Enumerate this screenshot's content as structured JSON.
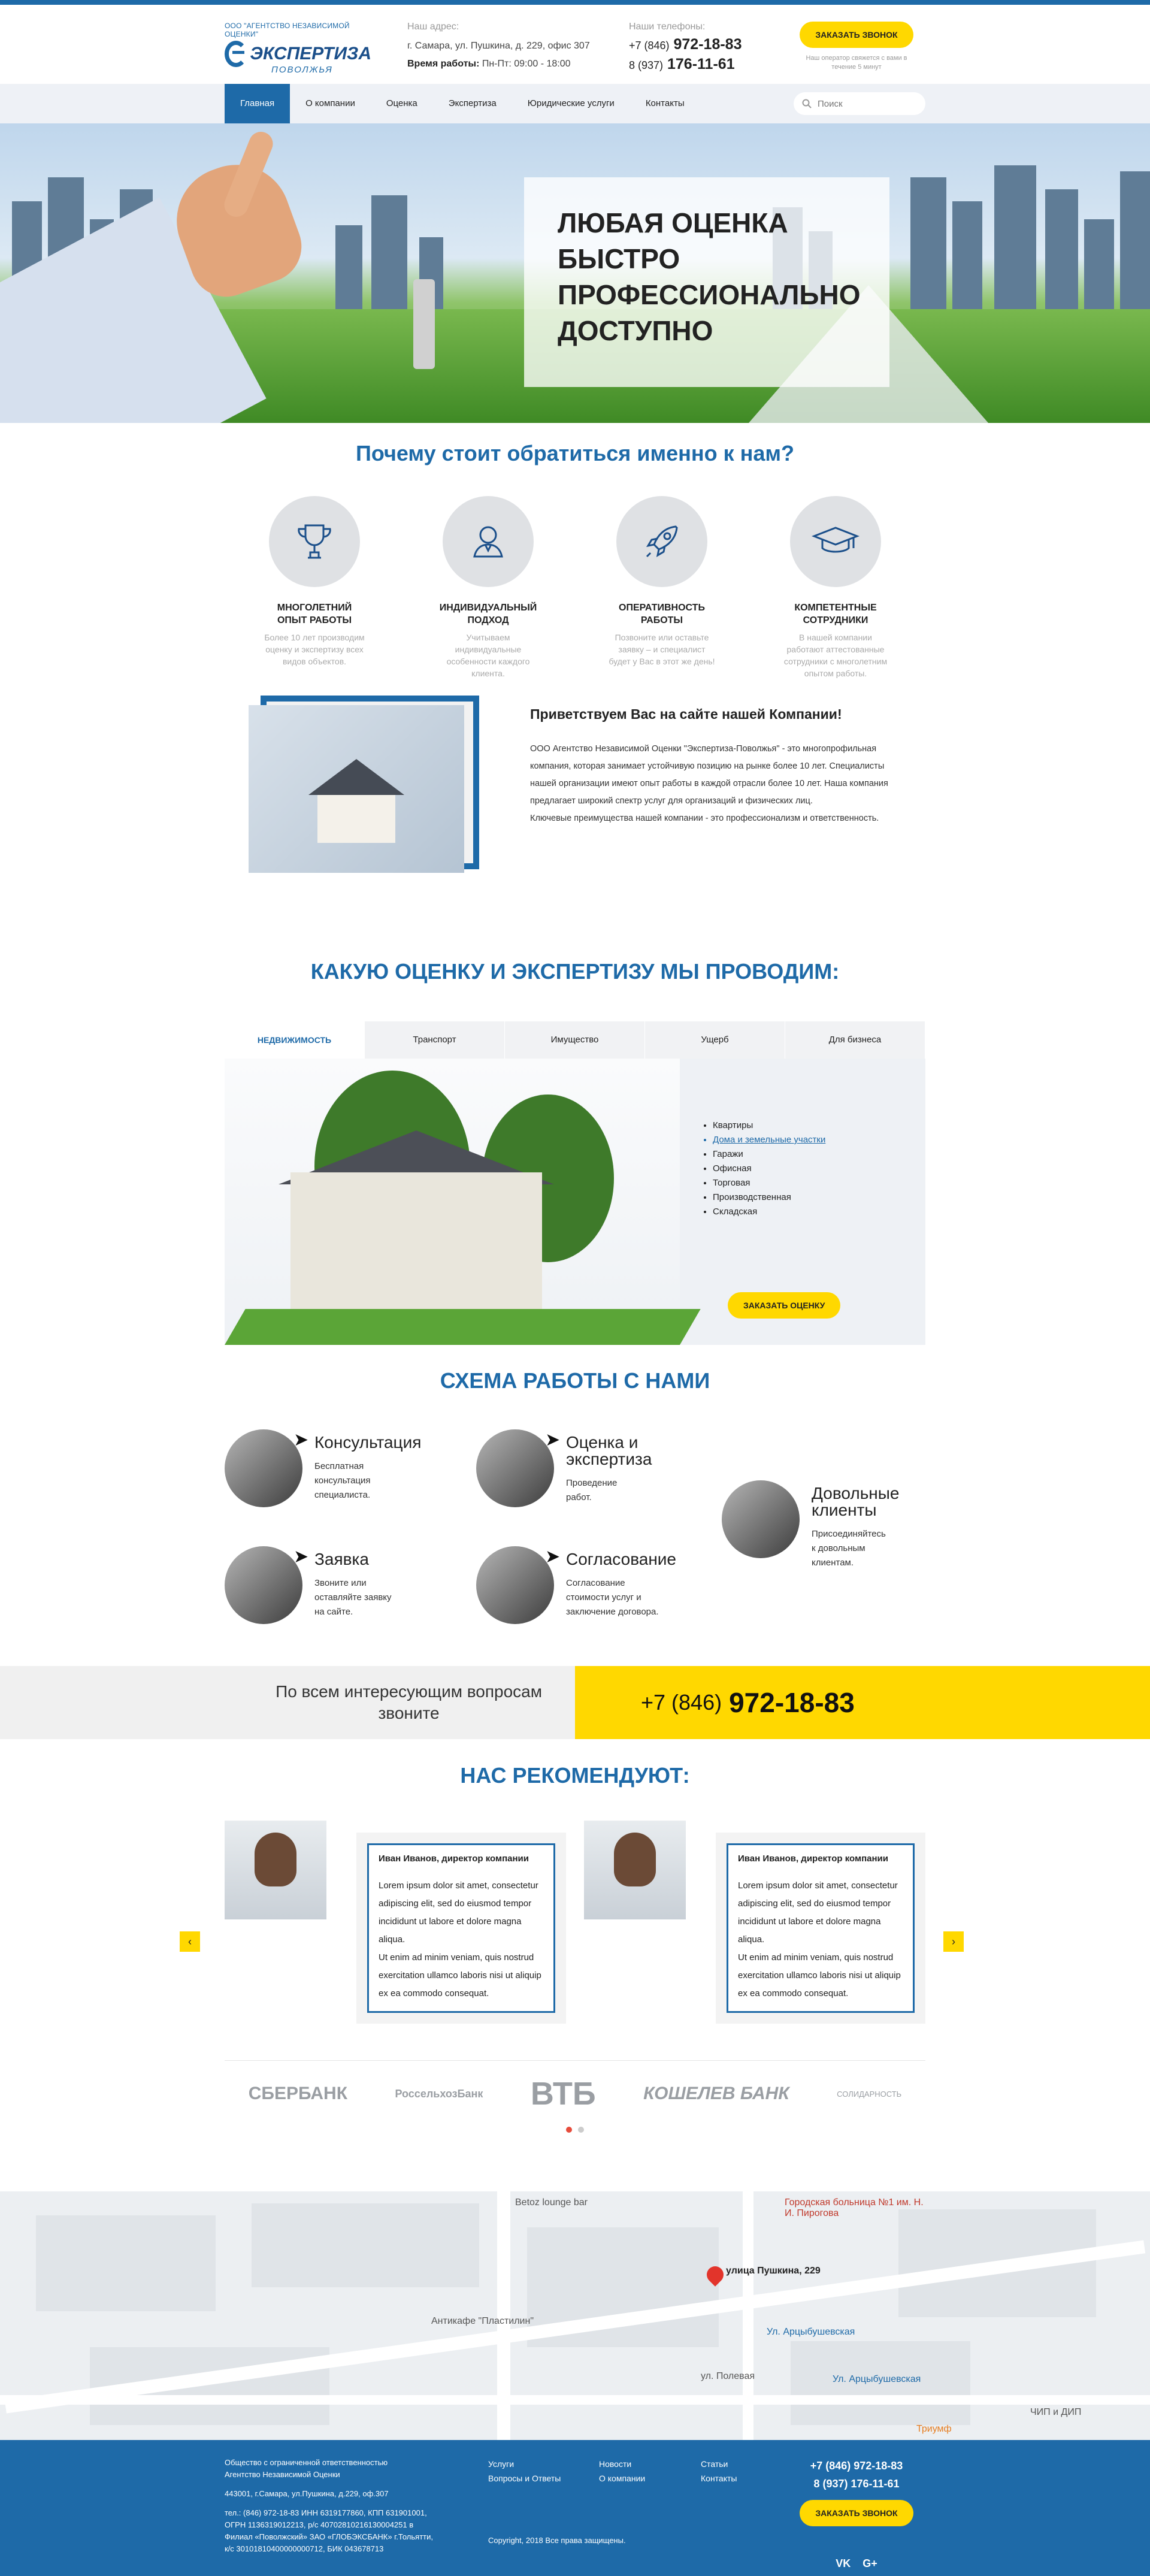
{
  "header": {
    "logo_small": "ООО \"АГЕНТСТВО НЕЗАВИСИМОЙ ОЦЕНКИ\"",
    "logo_main": "ЭКСПЕРТИЗА",
    "logo_sub": "ПОВОЛЖЬЯ",
    "address_label": "Наш адрес:",
    "address": "г. Самара, ул. Пушкина, д. 229, офис 307",
    "hours_label": "Время работы:",
    "hours": "Пн-Пт: 09:00 - 18:00",
    "phones_label": "Наши телефоны:",
    "phone1_code": "+7 (846)",
    "phone1_num": "972-18-83",
    "phone2_code": "8 (937)",
    "phone2_num": "176-11-61",
    "call_button": "ЗАКАЗАТЬ ЗВОНОК",
    "call_note": "Наш оператор свяжется с вами в течение 5 минут"
  },
  "nav": {
    "items": [
      "Главная",
      "О компании",
      "Оценка",
      "Экспертиза",
      "Юридические услуги",
      "Контакты"
    ],
    "search_placeholder": "Поиск"
  },
  "hero": {
    "lines": [
      "ЛЮБАЯ ОЦЕНКА",
      "БЫСТРО",
      "ПРОФЕССИОНАЛЬНО",
      "ДОСТУПНО"
    ]
  },
  "why": {
    "title": "Почему стоит обратиться именно к нам?",
    "features": [
      {
        "title1": "МНОГОЛЕТНИЙ",
        "title2": "ОПЫТ РАБОТЫ",
        "text": "Более 10 лет производим оценку и экспертизу всех видов объектов."
      },
      {
        "title1": "ИНДИВИДУАЛЬНЫЙ",
        "title2": "ПОДХОД",
        "text": "Учитываем индивидуальные особенности каждого клиента."
      },
      {
        "title1": "ОПЕРАТИВНОСТЬ",
        "title2": "РАБОТЫ",
        "text": "Позвоните или оставьте заявку – и специалист будет у Вас в этот же день!"
      },
      {
        "title1": "КОМПЕТЕНТНЫЕ",
        "title2": "СОТРУДНИКИ",
        "text": "В нашей компании работают аттестованные сотрудники с многолетним опытом работы."
      }
    ]
  },
  "welcome": {
    "title": "Приветствуем Вас на сайте нашей Компании!",
    "p1": "ООО Агентство Независимой Оценки \"Экспертиза-Поволжья\" - это многопрофильная компания, которая занимает устойчивую позицию на рынке более 10 лет. Специалисты нашей организации имеют опыт работы в каждой отрасли более 10 лет. Наша компания предлагает широкий спектр услуг для организаций и физических лиц.",
    "p2": "Ключевые преимущества нашей компании - это профессионализм и ответственность."
  },
  "services": {
    "title": "КАКУЮ ОЦЕНКУ И ЭКСПЕРТИЗУ МЫ ПРОВОДИМ:",
    "tabs": [
      "НЕДВИЖИМОСТЬ",
      "Транспорт",
      "Имущество",
      "Ущерб",
      "Для бизнеса"
    ],
    "list": [
      "Квартиры",
      "Дома и земельные участки",
      "Гаражи",
      "Офисная",
      "Торговая",
      "Производственная",
      "Складская"
    ],
    "button": "ЗАКАЗАТЬ ОЦЕНКУ"
  },
  "scheme": {
    "title": "СХЕМА РАБОТЫ С НАМИ",
    "steps": [
      {
        "title": "Консультация",
        "text1": "Бесплатная",
        "text2": "консультация",
        "text3": "специалиста."
      },
      {
        "title": "Оценка и",
        "title2": "экспертиза",
        "text1": "Проведение",
        "text2": "работ."
      },
      {
        "title": "Довольные",
        "title2": "клиенты",
        "text1": "Присоединяйтесь",
        "text2": "к довольным",
        "text3": "клиентам."
      },
      {
        "title": "Заявка",
        "text1": "Звоните или",
        "text2": "оставляйте заявку",
        "text3": "на сайте."
      },
      {
        "title": "Согласование",
        "text1": "Согласование",
        "text2": "стоимости услуг и",
        "text3": "заключение договора."
      }
    ]
  },
  "cta": {
    "text1": "По всем интересующим вопросам",
    "text2": "звоните",
    "code": "+7 (846)",
    "number": "972-18-83"
  },
  "reviews": {
    "title": "НАС РЕКОМЕНДУЮТ:",
    "items": [
      {
        "name": "Иван Иванов, директор компании",
        "p1": "Lorem ipsum dolor sit amet, consectetur adipiscing elit, sed do eiusmod tempor incididunt ut labore et dolore magna aliqua.",
        "p2": "Ut enim ad minim veniam, quis nostrud exercitation ullamco laboris nisi ut aliquip ex ea commodo consequat."
      },
      {
        "name": "Иван Иванов, директор компании",
        "p1": "Lorem ipsum dolor sit amet, consectetur adipiscing elit, sed do eiusmod tempor incididunt ut labore et dolore magna aliqua.",
        "p2": "Ut enim ad minim veniam, quis nostrud exercitation ullamco laboris nisi ut aliquip ex ea commodo consequat."
      }
    ],
    "prev": "‹",
    "next": "›"
  },
  "partners": [
    "СБЕРБАНК",
    "РоссельхозБанк",
    "ВТБ",
    "КОШЕЛЕВ БАНК",
    "СОЛИДАРНОСТЬ"
  ],
  "map": {
    "labels": [
      "Betoz lounge bar",
      "Городская больница №1 им. Н. И. Пирогова",
      "улица Пушкина, 229",
      "Антикафе \"Пластилин\"",
      "Ул. Арцыбушевская",
      "ул. Полевая",
      "Ул. Арцыбушевская",
      "Триумф",
      "ЧИП и ДИП"
    ]
  },
  "footer": {
    "org1": "Общество с ограниченной ответственностью",
    "org2": "Агентство Независимой Оценки",
    "addr": "443001, г.Самара, ул.Пушкина, д.229, оф.307",
    "req1": "тел.: (846) 972-18-83 ИНН 6319177860, КПП 631901001,",
    "req2": "ОГРН 1136319012213, р/с 40702810216130004251 в",
    "req3": "Филиал «Поволжский» ЗАО «ГЛОБЭКСБАНК» г.Тольятти,",
    "req4": "к/с 30101810400000000712, БИК 043678713",
    "menu1": [
      "Услуги",
      "Вопросы и Ответы"
    ],
    "menu2": [
      "Новости",
      "О компании"
    ],
    "menu3": [
      "Статьи",
      "Контакты"
    ],
    "phone1": "+7 (846) 972-18-83",
    "phone2": "8 (937) 176-11-61",
    "call_button": "ЗАКАЗАТЬ ЗВОНОК",
    "copyright": "Copyright, 2018  Все права защищены.",
    "social1": "VK",
    "social2": "G+"
  }
}
